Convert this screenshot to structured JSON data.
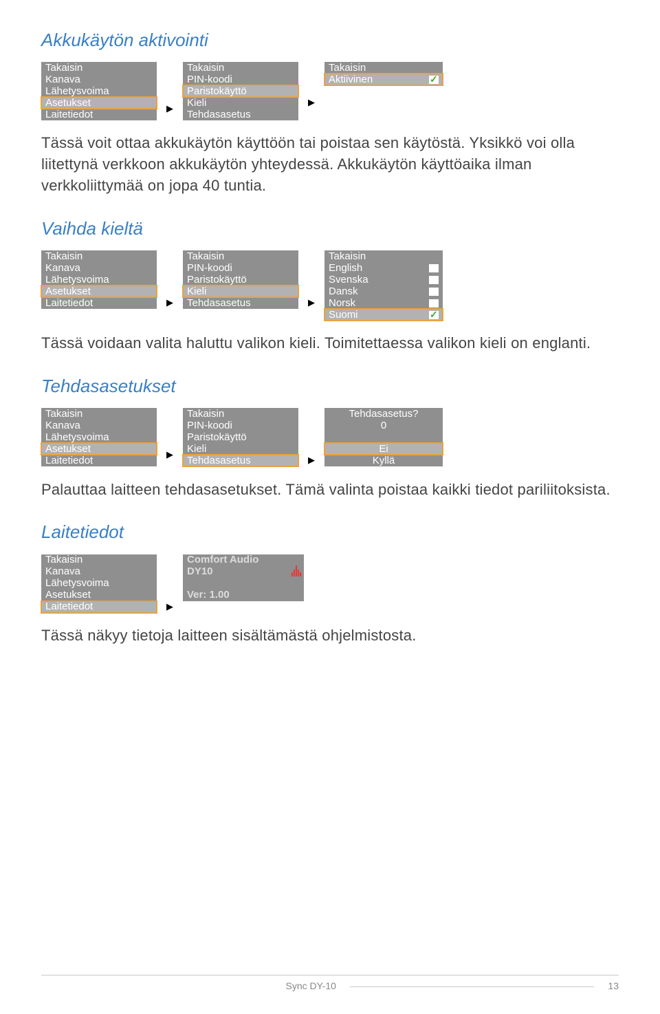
{
  "sections": {
    "akt": {
      "title": "Akkukäytön aktivointi",
      "menu1": [
        "Takaisin",
        "Kanava",
        "Lähetysvoima",
        "Asetukset",
        "Laitetiedot"
      ],
      "menu1_sel": 3,
      "menu2": [
        "Takaisin",
        "PIN-koodi",
        "Paristokäyttö",
        "Kieli",
        "Tehdasasetus"
      ],
      "menu2_sel": 2,
      "menu3": [
        {
          "label": "Takaisin"
        },
        {
          "label": "Aktiivinen",
          "chk": true,
          "checked": true
        }
      ],
      "menu3_sel": 1,
      "bodytext": "Tässä voit ottaa akkukäytön käyttöön tai poistaa sen käytöstä. Yksikkö voi olla liitettynä verkkoon akkukäytön yhteydessä. Akkukäytön käyttöaika ilman verkkoliittymää on jopa 40 tuntia."
    },
    "kieli": {
      "title": "Vaihda kieltä",
      "menu1": [
        "Takaisin",
        "Kanava",
        "Lähetysvoima",
        "Asetukset",
        "Laitetiedot"
      ],
      "menu1_sel": 3,
      "menu2": [
        "Takaisin",
        "PIN-koodi",
        "Paristokäyttö",
        "Kieli",
        "Tehdasasetus"
      ],
      "menu2_sel": 3,
      "menu3": [
        {
          "label": "Takaisin"
        },
        {
          "label": "English",
          "chk": true
        },
        {
          "label": "Svenska",
          "chk": true
        },
        {
          "label": "Dansk",
          "chk": true
        },
        {
          "label": "Norsk",
          "chk": true
        },
        {
          "label": "Suomi",
          "chk": true,
          "checked": true
        }
      ],
      "menu3_sel": 5,
      "bodytext": "Tässä voidaan valita haluttu valikon kieli. Toimitettaessa valikon kieli on englanti."
    },
    "tehdas": {
      "title": "Tehdasasetukset",
      "menu1": [
        "Takaisin",
        "Kanava",
        "Lähetysvoima",
        "Asetukset",
        "Laitetiedot"
      ],
      "menu1_sel": 3,
      "menu2": [
        "Takaisin",
        "PIN-koodi",
        "Paristokäyttö",
        "Kieli",
        "Tehdasasetus"
      ],
      "menu2_sel": 4,
      "menu3": {
        "question": "Tehdasasetus?",
        "value": "0",
        "opt_no": "Ei",
        "opt_yes": "Kyllä"
      },
      "bodytext": "Palauttaa laitteen tehdasasetukset. Tämä valinta poistaa kaikki tiedot pariliitoksista."
    },
    "laite": {
      "title": "Laitetiedot",
      "menu1": [
        "Takaisin",
        "Kanava",
        "Lähetysvoima",
        "Asetukset",
        "Laitetiedot"
      ],
      "menu1_sel": 4,
      "info": {
        "brand": "Comfort Audio",
        "model": "DY10",
        "ver_label": "Ver: 1.00"
      },
      "bodytext": "Tässä näkyy tietoja laitteen sisältämästä ohjelmistosta."
    }
  },
  "footer": {
    "product": "Sync DY-10",
    "page": "13"
  }
}
